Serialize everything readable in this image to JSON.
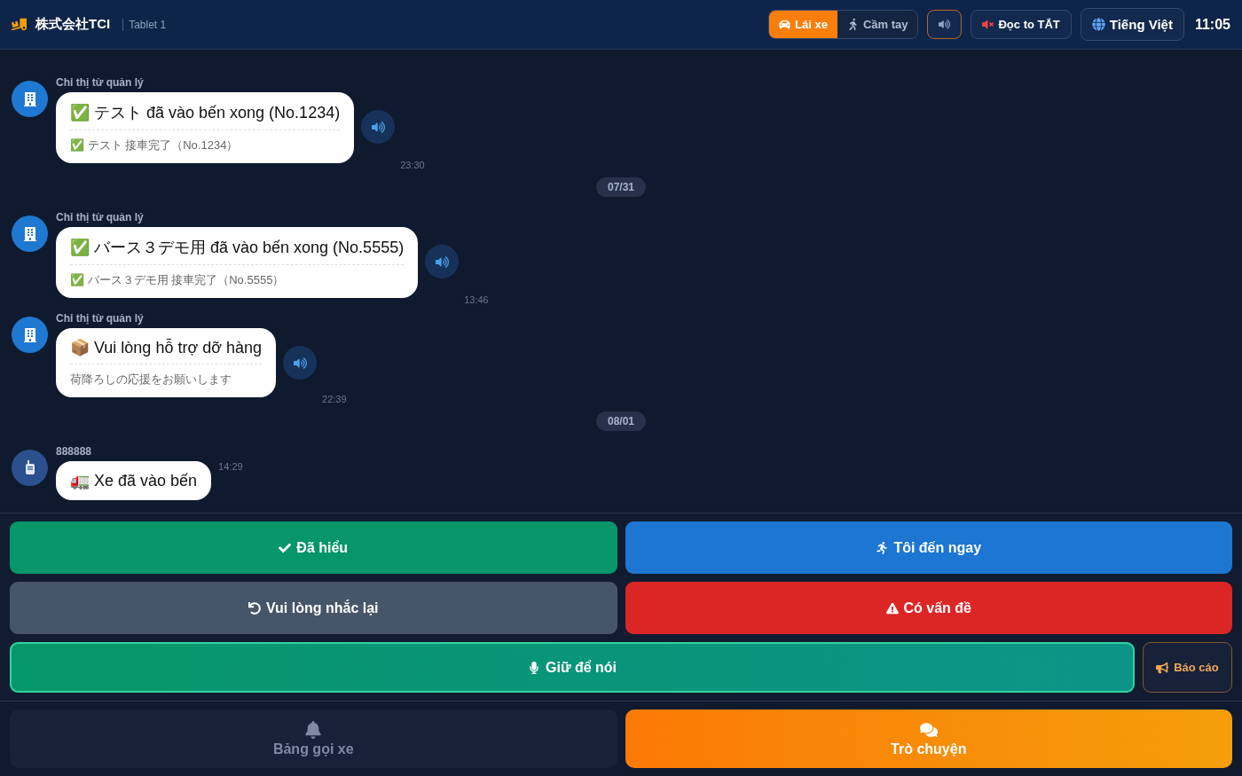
{
  "header": {
    "company": "株式会社TCI",
    "device": "Tablet 1",
    "mode_tabs": [
      {
        "label": "Lái xe",
        "kind": "drive",
        "selected": true
      },
      {
        "label": "Cầm tay",
        "kind": "handheld",
        "selected": false
      }
    ],
    "read_aloud": {
      "label": "Đọc to TẮT",
      "on": false
    },
    "language": "Tiếng Việt",
    "clock": "11:05"
  },
  "chat": [
    {
      "kind": "message",
      "from_manager": true,
      "sender": "Chỉ thị từ quản lý",
      "text": "✅ テスト đã vào bến xong (No.1234)",
      "subtext": "✅ テスト 接車完了（No.1234）",
      "time": "23:30",
      "speaker": true
    },
    {
      "kind": "date",
      "text": "07/31"
    },
    {
      "kind": "message",
      "from_manager": true,
      "sender": "Chỉ thị từ quản lý",
      "text": "✅ バース３デモ用 đã vào bến xong (No.5555)",
      "subtext": "✅ バース３デモ用 接車完了（No.5555）",
      "time": "13:46",
      "speaker": true
    },
    {
      "kind": "message",
      "from_manager": true,
      "sender": "Chỉ thị từ quản lý",
      "text": "📦 Vui lòng hỗ trợ dỡ hàng",
      "subtext": "荷降ろしの応援をお願いします",
      "time": "22:39",
      "speaker": true
    },
    {
      "kind": "date",
      "text": "08/01"
    },
    {
      "kind": "message",
      "from_manager": false,
      "sender": "888888",
      "text": "🚛 Xe đã vào bến",
      "time": "14:29",
      "speaker": false
    }
  ],
  "actions": [
    {
      "kind": "acknowledge",
      "label": "Đã hiểu"
    },
    {
      "kind": "coming",
      "label": "Tôi đến ngay"
    },
    {
      "kind": "repeat",
      "label": "Vui lòng nhắc lại"
    },
    {
      "kind": "problem",
      "label": "Có vấn đề"
    },
    {
      "kind": "talk",
      "label": "Giữ để nói"
    },
    {
      "kind": "report",
      "label": "Báo cáo"
    }
  ],
  "nav": [
    {
      "kind": "calls",
      "label": "Bảng gọi xe",
      "selected": false
    },
    {
      "kind": "chat",
      "label": "Trò chuyện",
      "selected": true
    }
  ]
}
